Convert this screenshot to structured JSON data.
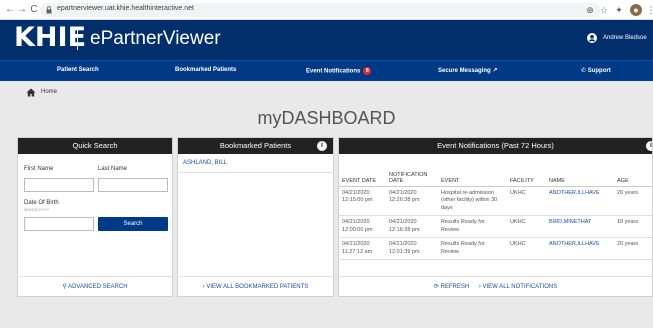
{
  "browser": {
    "url": "epartnerviewer.uat.khie.healthinteractive.net"
  },
  "header": {
    "logo_text": "KHIE",
    "app_title": "ePartnerViewer",
    "user_name": "Andrew Bledsoe"
  },
  "nav": {
    "items": [
      {
        "label": "Patient Search"
      },
      {
        "label": "Bookmarked Patients"
      },
      {
        "label": "Event Notifications",
        "badge": "8"
      },
      {
        "label": "Secure Messaging ↗"
      },
      {
        "label": "Support"
      }
    ]
  },
  "breadcrumb": {
    "home": "Home"
  },
  "page_title": "myDASHBOARD",
  "quick_search": {
    "title": "Quick Search",
    "first_name_label": "First Name",
    "last_name_label": "Last Name",
    "dob_label": "Date Of Birth",
    "dob_hint": "MM/DD/YYYY",
    "search_button": "Search",
    "advanced_link": "ADVANCED SEARCH"
  },
  "bookmarks": {
    "title": "Bookmarked Patients",
    "patients": [
      "ASHLAND, BILL"
    ],
    "view_all": "VIEW ALL BOOKMARKED PATIENTS"
  },
  "events": {
    "title": "Event Notifications (Past 72 Hours)",
    "columns": [
      "EVENT DATE",
      "NOTIFICATION DATE",
      "EVENT",
      "FACILITY",
      "NAME",
      "AGE"
    ],
    "rows": [
      {
        "event_date": "04/21/2020 12:15:00 pm",
        "notification_date": "04/21/2020 12:26:38 pm",
        "event": "Hospital re-admission (other facility) within 30 days",
        "facility": "UKHC",
        "name": "ANOTHER,ILLHAVE",
        "age": "20 years"
      },
      {
        "event_date": "04/21/2020 12:00:00 pm",
        "notification_date": "04/21/2020 12:16:38 pm",
        "event": "Results Ready for Review",
        "facility": "UKHC",
        "name": "BIRD,MINETHAT",
        "age": "19 years"
      },
      {
        "event_date": "04/21/2020 11:27:12 am",
        "notification_date": "04/21/2020 12:01:39 pm",
        "event": "Results Ready for Review",
        "facility": "UKHC",
        "name": "ANOTHER,ILLHAVE",
        "age": "20 years"
      }
    ],
    "refresh": "REFRESH",
    "view_all": "VIEW ALL NOTIFICATIONS"
  }
}
